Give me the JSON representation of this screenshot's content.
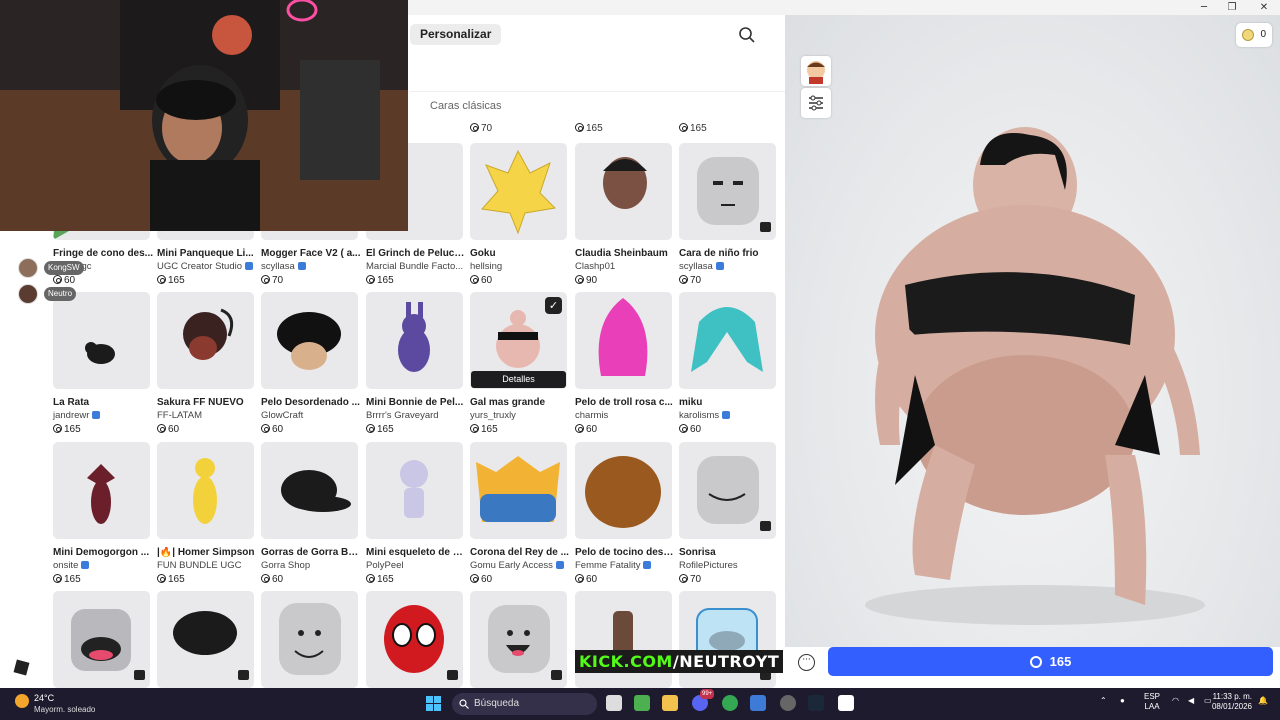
{
  "window": {
    "minimize_icon": "minimize-icon",
    "maximize_icon": "maximize-icon",
    "close_icon": "close-icon"
  },
  "topnav": {
    "tab_label": "Personalizar"
  },
  "subnav": {
    "label": "Caras clásicas"
  },
  "top_prices": [
    "70",
    "165",
    "165"
  ],
  "items": [
    {
      "name": "Fringe de cono des...",
      "creator": "cha...ugc",
      "price": "60",
      "verified": false,
      "bundle": false
    },
    {
      "name": "Mini Panqueque Li...",
      "creator": "UGC Creator Studio",
      "price": "165",
      "verified": true,
      "bundle": false
    },
    {
      "name": "Mogger Face V2 ( a...",
      "creator": "scyllasa",
      "price": "70",
      "verified": true,
      "bundle": false
    },
    {
      "name": "El Grinch de Peluch...",
      "creator": "Marcial Bundle Facto...",
      "price": "165",
      "verified": false,
      "bundle": false
    },
    {
      "name": "Goku",
      "creator": "hellsing",
      "price": "60",
      "verified": false,
      "bundle": false
    },
    {
      "name": "Claudia Sheinbaum",
      "creator": "Clashp01",
      "price": "90",
      "verified": false,
      "bundle": false
    },
    {
      "name": "Cara de niño frio",
      "creator": "scyllasa",
      "price": "70",
      "verified": true,
      "bundle": true
    },
    {
      "name": "La Rata",
      "creator": "jandrewr",
      "price": "165",
      "verified": true,
      "bundle": false
    },
    {
      "name": "Sakura FF NUEVO",
      "creator": "FF-LATAM",
      "price": "60",
      "verified": false,
      "bundle": false
    },
    {
      "name": "Pelo Desordenado ...",
      "creator": "GlowCraft",
      "price": "60",
      "verified": false,
      "bundle": false
    },
    {
      "name": "Mini Bonnie de Pel...",
      "creator": "Brrrr's Graveyard",
      "price": "165",
      "verified": false,
      "bundle": false
    },
    {
      "name": "Gal mas grande",
      "creator": "yurs_truxly",
      "price": "165",
      "verified": false,
      "bundle": false
    },
    {
      "name": "Pelo de troll rosa c...",
      "creator": "charmis",
      "price": "60",
      "verified": false,
      "bundle": false
    },
    {
      "name": "miku",
      "creator": "karolisms",
      "price": "60",
      "verified": true,
      "bundle": false
    },
    {
      "name": "Mini Demogorgon ...",
      "creator": "onsite",
      "price": "165",
      "verified": true,
      "bundle": false
    },
    {
      "name": "|🔥| Homer Simpson",
      "creator": "FUN BUNDLE UGC",
      "price": "165",
      "verified": false,
      "bundle": false
    },
    {
      "name": "Gorras de Gorra Ba...",
      "creator": "Gorra Shop",
      "price": "60",
      "verified": false,
      "bundle": false
    },
    {
      "name": "Mini esqueleto de s...",
      "creator": "PolyPeel",
      "price": "165",
      "verified": false,
      "bundle": false
    },
    {
      "name": "Corona del Rey de ...",
      "creator": "Gomu Early Access",
      "price": "60",
      "verified": true,
      "bundle": false
    },
    {
      "name": "Pelo de tocino deso...",
      "creator": "Femme Fatality",
      "price": "60",
      "verified": true,
      "bundle": false
    },
    {
      "name": "Sonrisa",
      "creator": "RofilePictures",
      "price": "70",
      "verified": false,
      "bundle": true
    }
  ],
  "selected_item": {
    "details_label": "Detalles",
    "check_icon": "check-icon"
  },
  "friends": [
    {
      "label": "KongSW"
    },
    {
      "label": "Neutro"
    }
  ],
  "preview": {
    "robux_balance": "0",
    "buy_price": "165",
    "more_icon": "more-icon"
  },
  "overlay": {
    "kick_prefix": "KICK.COM",
    "kick_suffix": "/NEUTROYT"
  },
  "taskbar": {
    "temperature": "24°C",
    "weather": "Mayorm. soleado",
    "search_label": "Búsqueda",
    "lang_top": "ESP",
    "lang_bottom": "LAA",
    "time": "11:33 p. m.",
    "date": "08/01/2026",
    "notification_count": "99+"
  },
  "colors": {
    "accent": "#335fff",
    "taskbar": "#1f1b2e",
    "thumb_bg": "#e9e9ec"
  }
}
